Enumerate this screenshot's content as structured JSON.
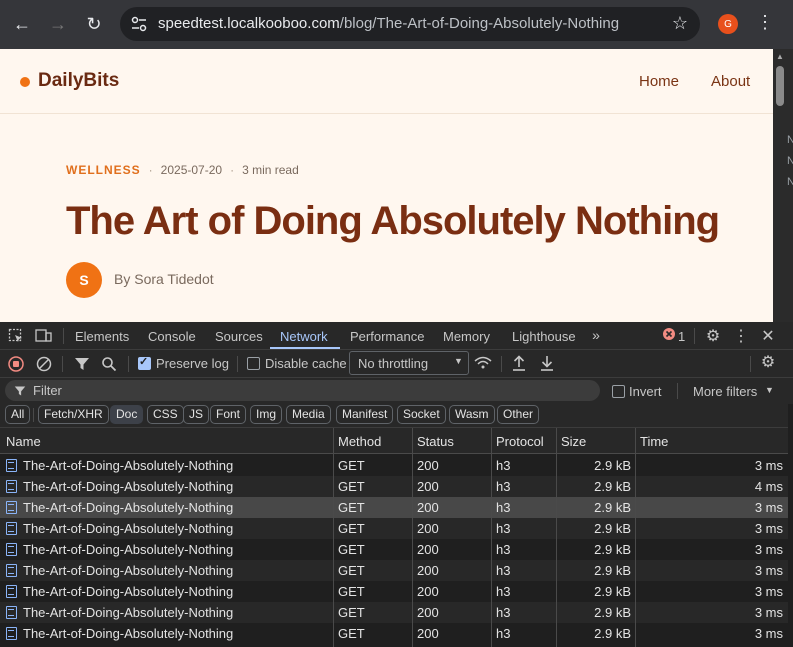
{
  "browser": {
    "url_host": "speedtest.localkooboo.com",
    "url_path": "/blog/The-Art-of-Doing-Absolutely-Nothing",
    "profile_initial": "G"
  },
  "page": {
    "logo": "DailyBits",
    "nav": [
      "Home",
      "About"
    ],
    "category": "WELLNESS",
    "date": "2025-07-20",
    "read_time": "3 min read",
    "title": "The Art of Doing Absolutely Nothing",
    "author_initial": "S",
    "byline": "By Sora Tidedot",
    "side_letters": [
      "N",
      "N",
      "N"
    ]
  },
  "devtools": {
    "tabs": [
      "Elements",
      "Console",
      "Sources",
      "Network",
      "Performance",
      "Memory",
      "Lighthouse"
    ],
    "active_tab": "Network",
    "error_count": "1",
    "preserve_log": "Preserve log",
    "disable_cache": "Disable cache",
    "throttling": "No throttling",
    "filter_placeholder": "Filter",
    "invert": "Invert",
    "more_filters": "More filters",
    "type_filters": [
      "All",
      "Fetch/XHR",
      "Doc",
      "CSS",
      "JS",
      "Font",
      "Img",
      "Media",
      "Manifest",
      "Socket",
      "Wasm",
      "Other"
    ],
    "active_type": "Doc",
    "columns": [
      "Name",
      "Method",
      "Status",
      "Protocol",
      "Size",
      "Time"
    ],
    "rows": [
      {
        "name": "The-Art-of-Doing-Absolutely-Nothing",
        "method": "GET",
        "status": "200",
        "protocol": "h3",
        "size": "2.9 kB",
        "time": "3 ms"
      },
      {
        "name": "The-Art-of-Doing-Absolutely-Nothing",
        "method": "GET",
        "status": "200",
        "protocol": "h3",
        "size": "2.9 kB",
        "time": "4 ms"
      },
      {
        "name": "The-Art-of-Doing-Absolutely-Nothing",
        "method": "GET",
        "status": "200",
        "protocol": "h3",
        "size": "2.9 kB",
        "time": "3 ms"
      },
      {
        "name": "The-Art-of-Doing-Absolutely-Nothing",
        "method": "GET",
        "status": "200",
        "protocol": "h3",
        "size": "2.9 kB",
        "time": "3 ms"
      },
      {
        "name": "The-Art-of-Doing-Absolutely-Nothing",
        "method": "GET",
        "status": "200",
        "protocol": "h3",
        "size": "2.9 kB",
        "time": "3 ms"
      },
      {
        "name": "The-Art-of-Doing-Absolutely-Nothing",
        "method": "GET",
        "status": "200",
        "protocol": "h3",
        "size": "2.9 kB",
        "time": "3 ms"
      },
      {
        "name": "The-Art-of-Doing-Absolutely-Nothing",
        "method": "GET",
        "status": "200",
        "protocol": "h3",
        "size": "2.9 kB",
        "time": "3 ms"
      },
      {
        "name": "The-Art-of-Doing-Absolutely-Nothing",
        "method": "GET",
        "status": "200",
        "protocol": "h3",
        "size": "2.9 kB",
        "time": "3 ms"
      },
      {
        "name": "The-Art-of-Doing-Absolutely-Nothing",
        "method": "GET",
        "status": "200",
        "protocol": "h3",
        "size": "2.9 kB",
        "time": "3 ms"
      }
    ],
    "selected_row": 2
  }
}
